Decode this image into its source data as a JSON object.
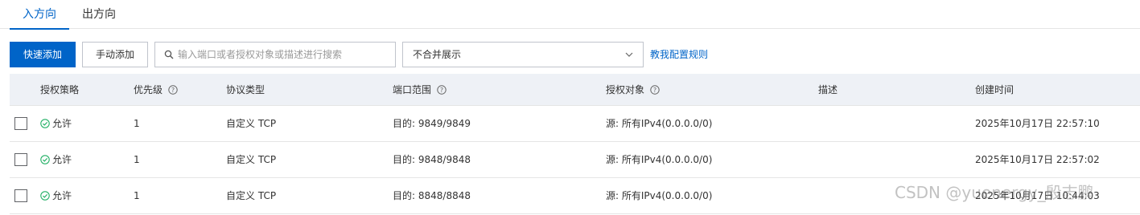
{
  "tabs": [
    {
      "label": "入方向",
      "active": true
    },
    {
      "label": "出方向",
      "active": false
    }
  ],
  "toolbar": {
    "quick_add_label": "快速添加",
    "manual_add_label": "手动添加",
    "search_placeholder": "输入端口或者授权对象或描述进行搜索",
    "search_value": "",
    "display_mode": "不合并展示",
    "help_link": "教我配置规则"
  },
  "table": {
    "headers": {
      "policy": "授权策略",
      "priority": "优先级",
      "protocol": "协议类型",
      "port_range": "端口范围",
      "source": "授权对象",
      "description": "描述",
      "created": "创建时间"
    },
    "rows": [
      {
        "policy": "允许",
        "priority": "1",
        "protocol": "自定义 TCP",
        "port_range": "目的: 9849/9849",
        "source": "源: 所有IPv4(0.0.0.0/0)",
        "description": "",
        "created": "2025年10月17日 22:57:10"
      },
      {
        "policy": "允许",
        "priority": "1",
        "protocol": "自定义 TCP",
        "port_range": "目的: 9848/9848",
        "source": "源: 所有IPv4(0.0.0.0/0)",
        "description": "",
        "created": "2025年10月17日 22:57:02"
      },
      {
        "policy": "允许",
        "priority": "1",
        "protocol": "自定义 TCP",
        "port_range": "目的: 8848/8848",
        "source": "源: 所有IPv4(0.0.0.0/0)",
        "description": "",
        "created": "2025年10月17日 10:44:03"
      }
    ]
  },
  "watermark": "CSDN @yuenergy_殷志鹏",
  "colors": {
    "accent": "#0064c8",
    "success": "#23b066",
    "header_bg": "#eef1f6"
  },
  "icons": {
    "search": "search-icon",
    "chevron": "chevron-down-icon",
    "help": "question-circle-icon",
    "allow": "check-circle-icon"
  }
}
